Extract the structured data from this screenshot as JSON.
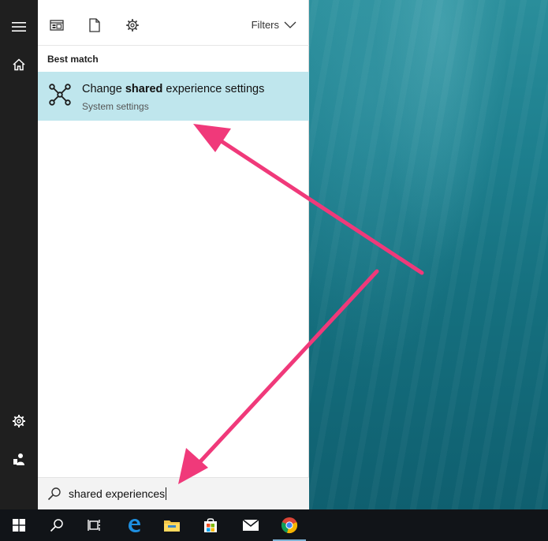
{
  "toolbar": {
    "filters_label": "Filters",
    "icons": [
      "apps-icon",
      "document-icon",
      "settings-icon",
      "chevron-down-icon"
    ]
  },
  "section": {
    "best_match": "Best match"
  },
  "result": {
    "title_prefix": "Change ",
    "title_bold": "shared",
    "title_suffix": " experience settings",
    "subtitle": "System settings",
    "icon": "network-nodes-icon"
  },
  "search": {
    "query": "shared experiences",
    "icon": "search-icon"
  },
  "left_rail": {
    "icons": [
      "hamburger-icon",
      "home-icon",
      "settings-icon",
      "account-icon"
    ]
  },
  "taskbar": {
    "items": [
      "windows-start-icon",
      "search-icon",
      "task-view-icon",
      "edge-icon",
      "file-explorer-icon",
      "store-icon",
      "mail-icon",
      "chrome-icon"
    ],
    "active": "chrome-icon"
  },
  "colors": {
    "accent_highlight": "#bfe6ed",
    "annotation_arrow": "#f0397a",
    "rail": "#1f1f1f",
    "taskbar": "#111418"
  }
}
